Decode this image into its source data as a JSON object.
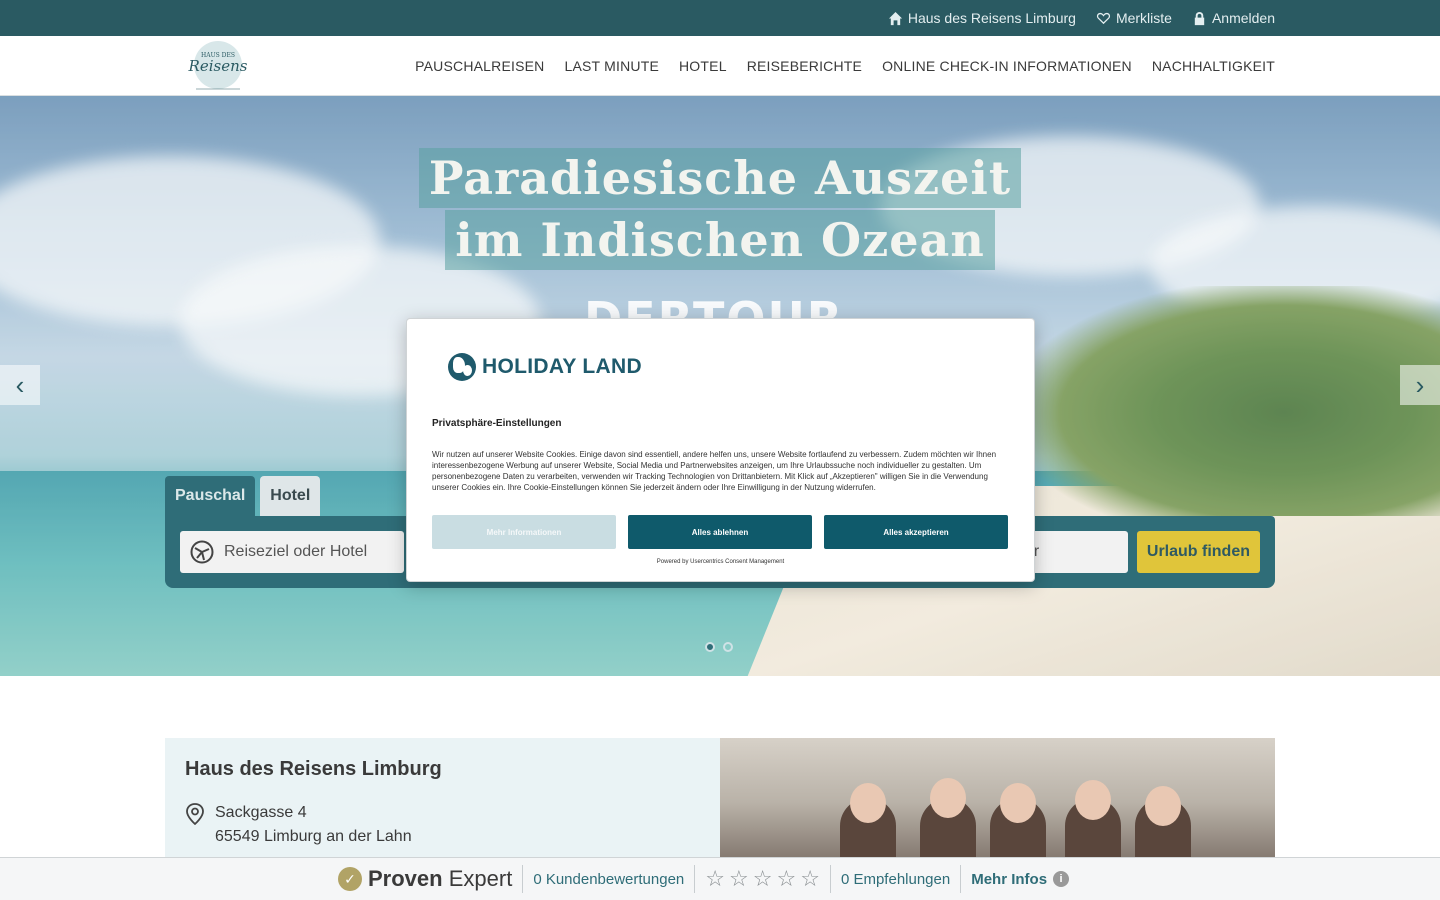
{
  "topbar": {
    "store_link": "Haus des Reisens Limburg",
    "wishlist_link": "Merkliste",
    "login_link": "Anmelden"
  },
  "nav": {
    "logo_alt": "Haus des Reisens",
    "items": [
      "PAUSCHALREISEN",
      "LAST MINUTE",
      "HOTEL",
      "REISEBERICHTE",
      "ONLINE CHECK-IN INFORMATIONEN",
      "NACHHALTIGKEIT"
    ]
  },
  "hero": {
    "headline_line1": "Paradiesische Auszeit",
    "headline_line2": "im Indischen Ozean",
    "brand": "DERTOUR",
    "arrow_prev": "‹",
    "arrow_next": "›"
  },
  "search": {
    "tabs": [
      "Pauschal",
      "Hotel"
    ],
    "destination_placeholder": "Reiseziel oder Hotel",
    "partial_field": "er",
    "submit": "Urlaub finden"
  },
  "info": {
    "title": "Haus des Reisens Limburg",
    "street": "Sackgasse 4",
    "city": "65549  Limburg an der Lahn"
  },
  "provenexpert": {
    "brand_bold": "Proven",
    "brand_regular": "Expert",
    "reviews": "0 Kundenbewertungen",
    "recommendations": "0 Empfehlungen",
    "more": "Mehr Infos"
  },
  "consent": {
    "logo_text": "HOLIDAY LAND",
    "title": "Privatsphäre-Einstellungen",
    "body": "Wir nutzen auf unserer Website Cookies. Einige davon sind essentiell, andere helfen uns, unsere Website fortlaufend zu verbessern. Zudem möchten wir Ihnen interessenbezogene Werbung auf unserer Website, Social Media und Partnerwebsites anzeigen, um Ihre Urlaubssuche noch individueller zu gestalten. Um personenbezogene Daten zu verarbeiten, verwenden wir Tracking Technologien von Drittanbietern. Mit Klick auf „Akzeptieren\" willigen Sie in die Verwendung unserer Cookies ein. Ihre Cookie-Einstellungen können Sie jederzeit ändern oder Ihre Einwilligung in der Nutzung widerrufen.",
    "btn_more": "Mehr Informationen",
    "btn_reject": "Alles ablehnen",
    "btn_accept": "Alles akzeptieren",
    "powered": "Powered by Usercentrics Consent Management"
  },
  "colors": {
    "topbar": "#2a5a62",
    "primary": "#2f6d78",
    "accent": "#e0c53a",
    "consent_button": "#0f5a6b"
  }
}
